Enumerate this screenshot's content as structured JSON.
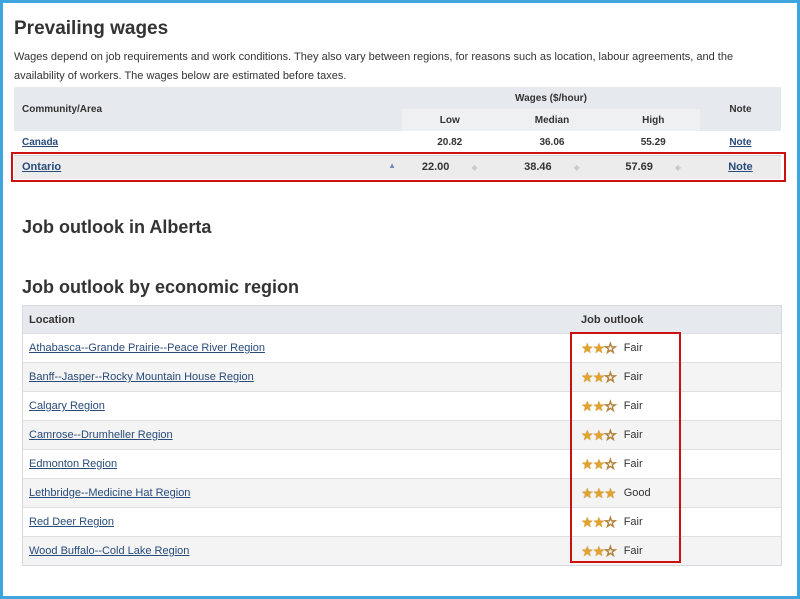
{
  "prevailing": {
    "title": "Prevailing wages",
    "intro": "Wages depend on job requirements and work conditions. They also vary between regions, for reasons such as location, labour agreements, and the availability of workers. The wages below are estimated before taxes."
  },
  "wages_table": {
    "col_community": "Community/Area",
    "col_group": "Wages ($/hour)",
    "col_low": "Low",
    "col_median": "Median",
    "col_high": "High",
    "col_note": "Note",
    "rows": [
      {
        "place": "Canada",
        "low": "20.82",
        "median": "36.06",
        "high": "55.29",
        "note": "Note"
      },
      {
        "place": "Ontario",
        "low": "22.00",
        "median": "38.46",
        "high": "57.69",
        "note": "Note"
      }
    ]
  },
  "outlook_alberta": {
    "title": "Job outlook in Alberta"
  },
  "outlook_region": {
    "title": "Job outlook by economic region",
    "col_location": "Location",
    "col_outlook": "Job outlook",
    "rows": [
      {
        "location": "Athabasca--Grande Prairie--Peace River Region",
        "stars": 2,
        "label": "Fair"
      },
      {
        "location": "Banff--Jasper--Rocky Mountain House Region",
        "stars": 2,
        "label": "Fair"
      },
      {
        "location": "Calgary Region",
        "stars": 2,
        "label": "Fair"
      },
      {
        "location": "Camrose--Drumheller Region",
        "stars": 2,
        "label": "Fair"
      },
      {
        "location": "Edmonton Region",
        "stars": 2,
        "label": "Fair"
      },
      {
        "location": "Lethbridge--Medicine Hat Region",
        "stars": 3,
        "label": "Good"
      },
      {
        "location": "Red Deer Region",
        "stars": 2,
        "label": "Fair"
      },
      {
        "location": "Wood Buffalo--Cold Lake Region",
        "stars": 2,
        "label": "Fair"
      }
    ]
  },
  "colors": {
    "frame": "#3ea6dc",
    "highlight": "#cc1111",
    "link": "#284b7a",
    "star": "#e3a32a"
  }
}
